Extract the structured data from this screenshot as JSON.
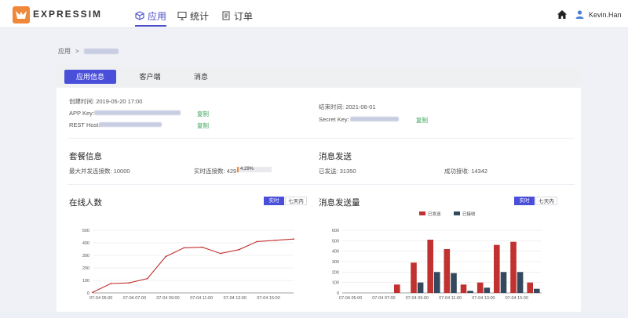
{
  "header": {
    "logo_text": "EXPRESSIM",
    "nav": [
      {
        "label": "应用",
        "icon": "cube-icon"
      },
      {
        "label": "统计",
        "icon": "monitor-icon"
      },
      {
        "label": "订单",
        "icon": "document-icon"
      }
    ],
    "user_name": "Kevin.Han"
  },
  "breadcrumb": {
    "root": "应用",
    "separator": ">"
  },
  "tabs": [
    {
      "label": "应用信息"
    },
    {
      "label": "客户端"
    },
    {
      "label": "消息"
    }
  ],
  "app_info": {
    "created_label": "创建时间:",
    "created_value": "2019-05-20 17:00",
    "expire_label": "结束时间:",
    "expire_value": "2021-06-01",
    "app_key_label": "APP Key:",
    "rest_host_label": "REST Host:",
    "secret_key_label": "Secret Key:",
    "copy_label": "复制"
  },
  "package": {
    "title": "套餐信息",
    "max_conn_label": "最大并发连接数:",
    "max_conn_value": "10000",
    "realtime_conn_label": "实时连接数:",
    "realtime_conn_value": "429",
    "usage_percent": "4.29%",
    "usage_fraction": 0.0429
  },
  "messages": {
    "title": "消息发送",
    "sent_label": "已发送:",
    "sent_value": "31350",
    "received_label": "成功接收:",
    "received_value": "14342"
  },
  "toggles": {
    "realtime": "实时",
    "seven_days": "七天内"
  },
  "colors": {
    "accent": "#4a4fd9",
    "sent": "#c0312f",
    "received": "#34495e",
    "line": "#c0312f"
  },
  "chart_data": [
    {
      "type": "line",
      "title": "在线人数",
      "x": [
        "07-04 05:00",
        "07-04 06:00",
        "07-04 07:00",
        "07-04 08:00",
        "07-04 09:00",
        "07-04 10:00",
        "07-04 11:00",
        "07-04 12:00",
        "07-04 13:00",
        "07-04 14:00",
        "07-04 15:00",
        "07-04 16:00"
      ],
      "xticks": [
        "07-04 05:00",
        "07-04 07:00",
        "07-04 09:00",
        "07-04 11:00",
        "07-04 13:00",
        "07-04 15:00"
      ],
      "values": [
        5,
        75,
        80,
        115,
        290,
        360,
        365,
        315,
        345,
        410,
        420,
        430
      ],
      "ylim": [
        0,
        500
      ],
      "yticks": [
        0,
        100,
        200,
        300,
        400,
        500
      ],
      "grid": true
    },
    {
      "type": "bar",
      "title": "消息发送量",
      "x": [
        "07-04 05:00",
        "07-04 06:00",
        "07-04 07:00",
        "07-04 08:00",
        "07-04 09:00",
        "07-04 10:00",
        "07-04 11:00",
        "07-04 12:00",
        "07-04 13:00",
        "07-04 14:00",
        "07-04 15:00",
        "07-04 16:00"
      ],
      "xticks": [
        "07-04 05:00",
        "07-04 07:00",
        "07-04 09:00",
        "07-04 11:00",
        "07-04 13:00",
        "07-04 15:00"
      ],
      "series": [
        {
          "name": "已发送",
          "values": [
            0,
            0,
            0,
            80,
            290,
            510,
            420,
            80,
            100,
            460,
            490,
            100
          ]
        },
        {
          "name": "已接收",
          "values": [
            0,
            0,
            0,
            0,
            100,
            200,
            190,
            20,
            50,
            200,
            200,
            40
          ]
        }
      ],
      "ylim": [
        0,
        600
      ],
      "yticks": [
        0,
        100,
        200,
        300,
        400,
        500,
        600
      ],
      "legend": "top-center",
      "grid": true
    }
  ]
}
